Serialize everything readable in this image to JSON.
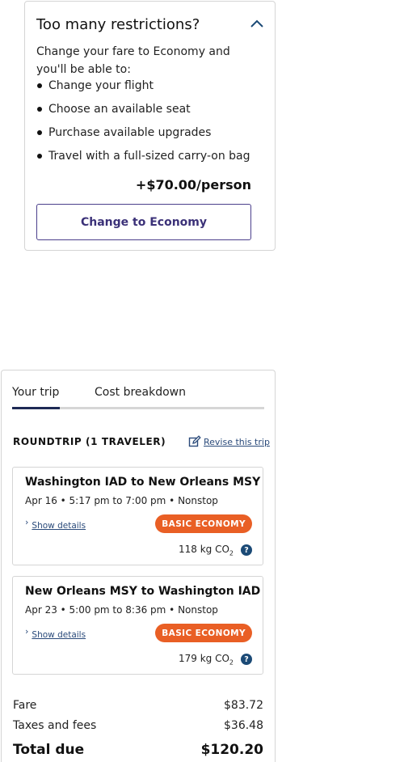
{
  "restrictions": {
    "title": "Too many restrictions?",
    "intro": "Change your fare to Economy and you'll be able to:",
    "benefits": [
      "Change your flight",
      "Choose an available seat",
      "Purchase available upgrades",
      "Travel with a full-sized carry-on bag"
    ],
    "price": "+$70.00/person",
    "button_label": "Change to Economy",
    "toggle_icon": "chevron-up-icon"
  },
  "trip": {
    "tabs": [
      {
        "label": "Your trip",
        "active": true
      },
      {
        "label": "Cost breakdown",
        "active": false
      }
    ],
    "roundtrip_label": "ROUNDTRIP (1 TRAVELER)",
    "revise_label": "Revise this trip",
    "flights": [
      {
        "route": "Washington IAD to New Orleans MSY",
        "times": "Apr 16 • 5:17 pm to 7:00 pm • Nonstop",
        "details_label": "Show details",
        "badge": "BASIC ECONOMY",
        "co2_value": "118 kg CO",
        "co2_sub": "2",
        "help": "?"
      },
      {
        "route": "New Orleans MSY to Washington IAD",
        "times": "Apr 23 • 5:00 pm to 8:36 pm • Nonstop",
        "details_label": "Show details",
        "badge": "BASIC ECONOMY",
        "co2_value": "179 kg CO",
        "co2_sub": "2",
        "help": "?"
      }
    ],
    "summary": {
      "fare_label": "Fare",
      "fare_value": "$83.72",
      "taxes_label": "Taxes and fees",
      "taxes_value": "$36.48",
      "total_label": "Total due",
      "total_value": "$120.20"
    }
  },
  "colors": {
    "accent_purple": "#3b3178",
    "badge_orange": "#e95f25",
    "link_blue": "#2a4a7a",
    "tab_active": "#1e2a55"
  }
}
